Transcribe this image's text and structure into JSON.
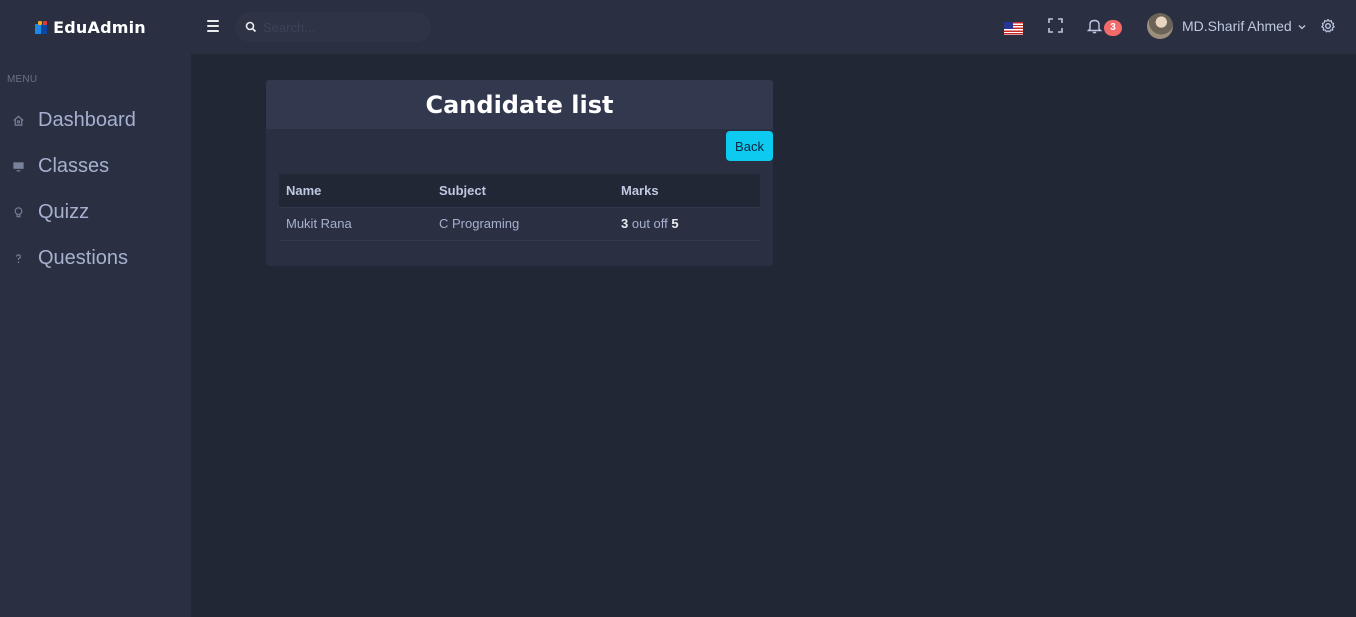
{
  "brand": {
    "name": "EduAdmin"
  },
  "sidebar": {
    "menu_title": "MENU",
    "items": [
      {
        "label": "Dashboard",
        "icon": "home-icon"
      },
      {
        "label": "Classes",
        "icon": "monitor-icon"
      },
      {
        "label": "Quizz",
        "icon": "lightbulb-icon"
      },
      {
        "label": "Questions",
        "icon": "question-icon"
      }
    ]
  },
  "header": {
    "search_placeholder": "Search...",
    "notification_count": "3",
    "user_name": "MD.Sharif Ahmed",
    "language": "us-flag-icon"
  },
  "card": {
    "title": "Candidate list",
    "back_label": "Back",
    "columns": [
      "Name",
      "Subject",
      "Marks"
    ],
    "rows": [
      {
        "name": "Mukit Rana",
        "subject": "C Programing",
        "score": "3",
        "out_of_text": "out off",
        "total": "5"
      }
    ]
  },
  "colors": {
    "background": "#222736",
    "sidebar": "#2a3042",
    "accent": "#0dcaf0",
    "badge": "#f46a6a"
  }
}
